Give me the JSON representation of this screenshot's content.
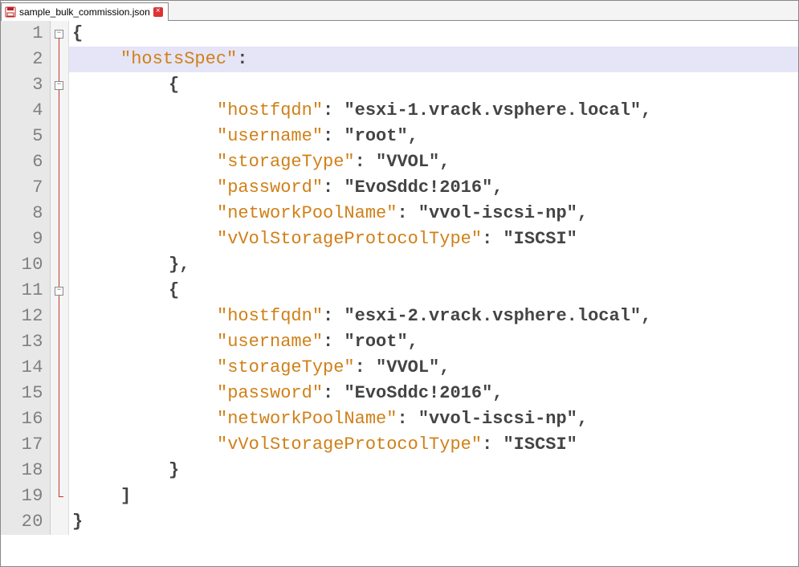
{
  "tab": {
    "label": "sample_bulk_commission.json"
  },
  "highlight_line": 2,
  "lines": [
    {
      "num": 1,
      "fold": "box",
      "indent": 0,
      "tokens": [
        [
          "brace",
          "{"
        ]
      ]
    },
    {
      "num": 2,
      "fold": "line",
      "indent": 1,
      "tokens": [
        [
          "key",
          "\"hostsSpec\""
        ],
        [
          "punct",
          ":"
        ]
      ]
    },
    {
      "num": 3,
      "fold": "box-inline",
      "indent": 2,
      "tokens": [
        [
          "brace",
          "{"
        ]
      ]
    },
    {
      "num": 4,
      "fold": "line",
      "indent": 3,
      "tokens": [
        [
          "key",
          "\"hostfqdn\""
        ],
        [
          "punct",
          ": "
        ],
        [
          "str",
          "\"esxi-1.vrack.vsphere.local\""
        ],
        [
          "punct",
          ","
        ]
      ]
    },
    {
      "num": 5,
      "fold": "line",
      "indent": 3,
      "tokens": [
        [
          "key",
          "\"username\""
        ],
        [
          "punct",
          ": "
        ],
        [
          "str",
          "\"root\""
        ],
        [
          "punct",
          ","
        ]
      ]
    },
    {
      "num": 6,
      "fold": "line",
      "indent": 3,
      "tokens": [
        [
          "key",
          "\"storageType\""
        ],
        [
          "punct",
          ": "
        ],
        [
          "str",
          "\"VVOL\""
        ],
        [
          "punct",
          ","
        ]
      ]
    },
    {
      "num": 7,
      "fold": "line",
      "indent": 3,
      "tokens": [
        [
          "key",
          "\"password\""
        ],
        [
          "punct",
          ": "
        ],
        [
          "str",
          "\"EvoSddc!2016\""
        ],
        [
          "punct",
          ","
        ]
      ]
    },
    {
      "num": 8,
      "fold": "line",
      "indent": 3,
      "tokens": [
        [
          "key",
          "\"networkPoolName\""
        ],
        [
          "punct",
          ": "
        ],
        [
          "str",
          "\"vvol-iscsi-np\""
        ],
        [
          "punct",
          ","
        ]
      ]
    },
    {
      "num": 9,
      "fold": "line",
      "indent": 3,
      "tokens": [
        [
          "key",
          "\"vVolStorageProtocolType\""
        ],
        [
          "punct",
          ": "
        ],
        [
          "str",
          "\"ISCSI\""
        ]
      ]
    },
    {
      "num": 10,
      "fold": "line",
      "indent": 2,
      "tokens": [
        [
          "brace",
          "}"
        ],
        [
          "punct",
          ","
        ]
      ]
    },
    {
      "num": 11,
      "fold": "box-inline",
      "indent": 2,
      "tokens": [
        [
          "brace",
          "{"
        ]
      ]
    },
    {
      "num": 12,
      "fold": "line",
      "indent": 3,
      "tokens": [
        [
          "key",
          "\"hostfqdn\""
        ],
        [
          "punct",
          ": "
        ],
        [
          "str",
          "\"esxi-2.vrack.vsphere.local\""
        ],
        [
          "punct",
          ","
        ]
      ]
    },
    {
      "num": 13,
      "fold": "line",
      "indent": 3,
      "tokens": [
        [
          "key",
          "\"username\""
        ],
        [
          "punct",
          ": "
        ],
        [
          "str",
          "\"root\""
        ],
        [
          "punct",
          ","
        ]
      ]
    },
    {
      "num": 14,
      "fold": "line",
      "indent": 3,
      "tokens": [
        [
          "key",
          "\"storageType\""
        ],
        [
          "punct",
          ": "
        ],
        [
          "str",
          "\"VVOL\""
        ],
        [
          "punct",
          ","
        ]
      ]
    },
    {
      "num": 15,
      "fold": "line",
      "indent": 3,
      "tokens": [
        [
          "key",
          "\"password\""
        ],
        [
          "punct",
          ": "
        ],
        [
          "str",
          "\"EvoSddc!2016\""
        ],
        [
          "punct",
          ","
        ]
      ]
    },
    {
      "num": 16,
      "fold": "line",
      "indent": 3,
      "tokens": [
        [
          "key",
          "\"networkPoolName\""
        ],
        [
          "punct",
          ": "
        ],
        [
          "str",
          "\"vvol-iscsi-np\""
        ],
        [
          "punct",
          ","
        ]
      ]
    },
    {
      "num": 17,
      "fold": "line",
      "indent": 3,
      "tokens": [
        [
          "key",
          "\"vVolStorageProtocolType\""
        ],
        [
          "punct",
          ": "
        ],
        [
          "str",
          "\"ISCSI\""
        ]
      ]
    },
    {
      "num": 18,
      "fold": "line",
      "indent": 2,
      "tokens": [
        [
          "brace",
          "}"
        ]
      ]
    },
    {
      "num": 19,
      "fold": "end",
      "indent": 1,
      "tokens": [
        [
          "brace",
          "]"
        ]
      ]
    },
    {
      "num": 20,
      "fold": "none",
      "indent": 0,
      "tokens": [
        [
          "brace",
          "}"
        ]
      ]
    }
  ]
}
